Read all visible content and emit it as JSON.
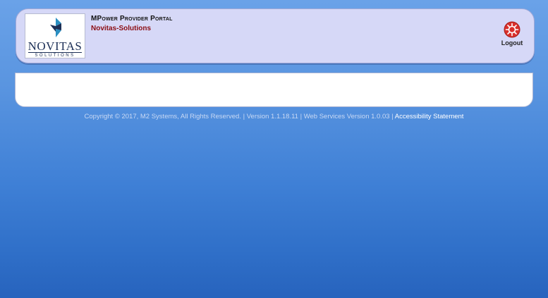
{
  "header": {
    "logo_word": "NOVITAS",
    "logo_sub": "SOLUTIONS",
    "portal_title": "MPower Provider Portal",
    "organization": "Novitas-Solutions",
    "logout_label": "Logout",
    "logout_icon": "logout-icon"
  },
  "footer": {
    "copyright": "Copyright © 2017, M2 Systems, All Rights Reserved.",
    "separator": "|",
    "version": "Version 1.1.18.11",
    "web_services_version": "Web Services Version 1.0.03",
    "accessibility_link": "Accessibility Statement"
  },
  "colors": {
    "header_bg": "#d6d8f7",
    "org_name": "#8b0c12",
    "logout_icon": "#d9302c",
    "page_bg_top": "#6aa2e8",
    "page_bg_bottom": "#2763bd"
  }
}
